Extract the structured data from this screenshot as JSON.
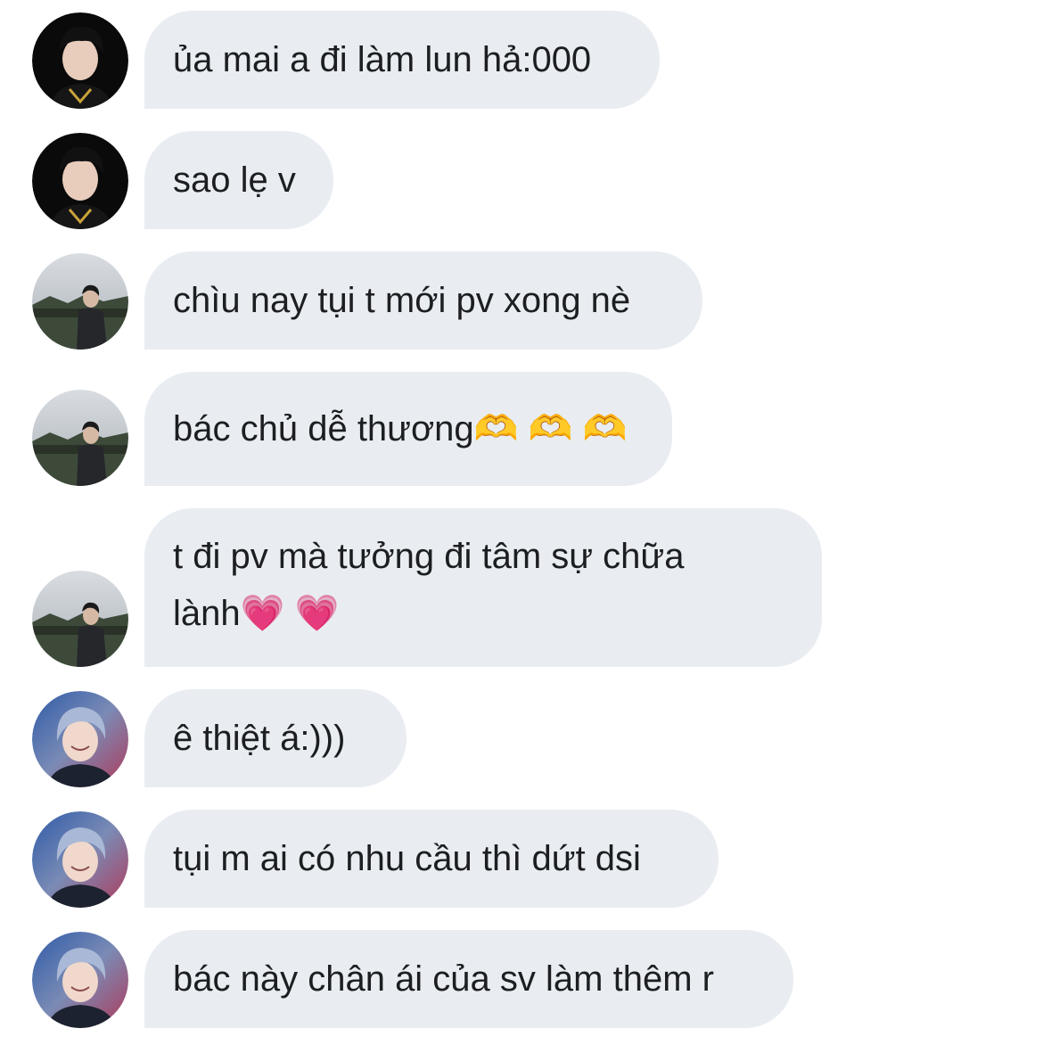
{
  "colors": {
    "bubble_bg": "#e9edf2",
    "text": "#1c1e21",
    "background": "#ffffff"
  },
  "messages": [
    {
      "avatar": "avatar-dark-hair-boy-icon",
      "text": "ủa mai a đi làm lun hả:000"
    },
    {
      "avatar": "avatar-dark-hair-boy-icon",
      "text": "sao lẹ v"
    },
    {
      "avatar": "avatar-outdoor-boy-icon",
      "text": "chìu nay tụi t mới pv xong nè"
    },
    {
      "avatar": "avatar-outdoor-boy-icon",
      "text": "bác chủ dễ thương🫶 🫶 🫶"
    },
    {
      "avatar": "avatar-outdoor-boy-icon",
      "text": "t đi pv mà tưởng đi tâm sự chữa lành💗 💗"
    },
    {
      "avatar": "avatar-blue-hair-boy-icon",
      "text": "ê thiệt á:)))"
    },
    {
      "avatar": "avatar-blue-hair-boy-icon",
      "text": "tụi m ai có nhu cầu thì dứt dsi"
    },
    {
      "avatar": "avatar-blue-hair-boy-icon",
      "text": "bác này chân ái của sv làm thêm r"
    }
  ]
}
